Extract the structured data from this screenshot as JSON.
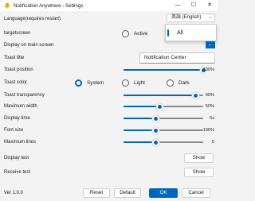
{
  "window": {
    "title": "Notification Anywhere - Settings",
    "minimize_glyph": "—",
    "maximize_glyph": "☐",
    "close_glyph": "✕"
  },
  "language": {
    "label": "Language(requires restart)",
    "value": "英語 (English)",
    "chevron": "⌄",
    "popup_option": "All"
  },
  "targetscreen": {
    "label": "targetscreen",
    "option_active": "Active"
  },
  "display_on_main": {
    "label": "Display on main screen",
    "chevron": "⌄"
  },
  "toast_title": {
    "label": "Toast title",
    "value": "Notification Center"
  },
  "toast_position": {
    "label": "Toast position",
    "value_text": "100%",
    "level": 1.0
  },
  "toast_color": {
    "label": "Toast color",
    "options": [
      "System",
      "Light",
      "Dark"
    ],
    "selected": "System"
  },
  "sliders": [
    {
      "label": "Toast transparency",
      "value_text": "90%",
      "level": 0.9
    },
    {
      "label": "Maximum width",
      "value_text": "50%",
      "level": 0.45
    },
    {
      "label": "Display time",
      "value_text": "5s",
      "level": 0.4
    },
    {
      "label": "Font size",
      "value_text": "100%",
      "level": 0.4
    },
    {
      "label": "Maximum lines",
      "value_text": "5",
      "level": 0.4
    }
  ],
  "display_test": {
    "label": "Display test",
    "button": "Show"
  },
  "receive_test": {
    "label": "Receive test",
    "button": "Show"
  },
  "footer": {
    "version": "Ver 1.0.0",
    "reset": "Reset",
    "default": "Default",
    "ok": "OK",
    "cancel": "Cancel"
  },
  "colors": {
    "accent": "#0067c0",
    "background": "#f3f3f3"
  },
  "icons": [
    "app-bell-icon",
    "minimize-icon",
    "maximize-icon",
    "close-icon",
    "chevron-down-icon"
  ]
}
